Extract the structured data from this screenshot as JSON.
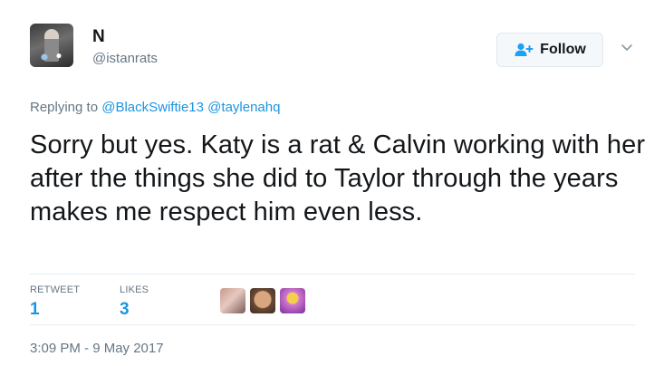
{
  "user": {
    "display_name": "N",
    "screen_name": "@istanrats"
  },
  "follow_button": {
    "label": "Follow"
  },
  "reply_context": {
    "prefix": "Replying to",
    "mentions": [
      "@BlackSwiftie13",
      "@taylenahq"
    ]
  },
  "tweet": {
    "text": "Sorry but yes. Katy is a rat & Calvin working with her after the things she did to Taylor through the years makes me respect him even less."
  },
  "stats": {
    "retweets": {
      "label": "RETWEET",
      "count": "1"
    },
    "likes": {
      "label": "LIKES",
      "count": "3"
    }
  },
  "timestamp": "3:09 PM - 9 May 2017",
  "icons": {
    "follow": "add-person-icon",
    "menu": "chevron-down-icon"
  },
  "colors": {
    "link": "#1b95e0",
    "secondary_text": "#657786",
    "primary_text": "#14171a"
  }
}
